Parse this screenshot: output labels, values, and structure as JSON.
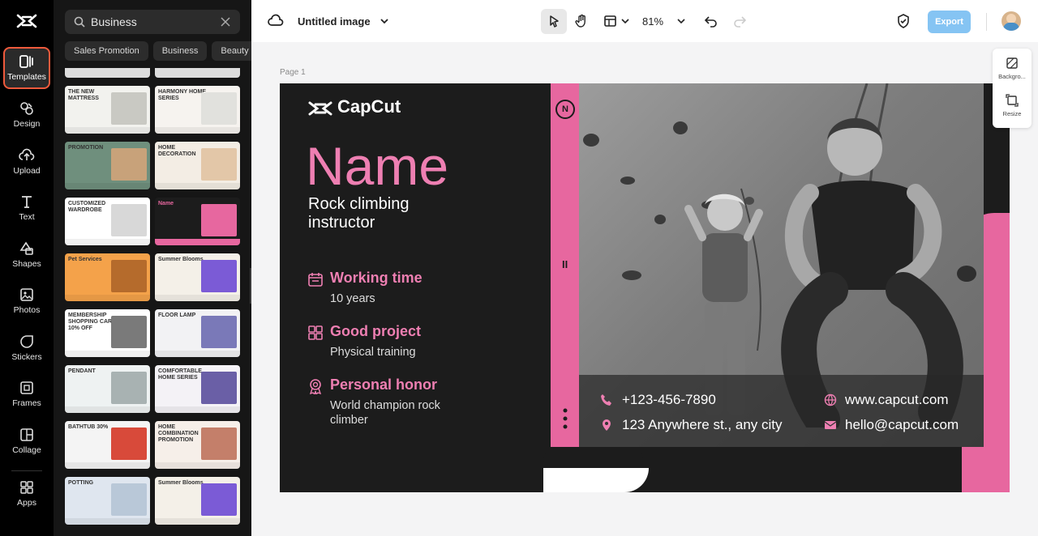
{
  "rail": {
    "items": [
      {
        "label": "Templates",
        "icon": "templates-icon",
        "active": true
      },
      {
        "label": "Design",
        "icon": "design-icon"
      },
      {
        "label": "Upload",
        "icon": "upload-icon"
      },
      {
        "label": "Text",
        "icon": "text-icon"
      },
      {
        "label": "Shapes",
        "icon": "shapes-icon"
      },
      {
        "label": "Photos",
        "icon": "photos-icon"
      },
      {
        "label": "Stickers",
        "icon": "stickers-icon"
      },
      {
        "label": "Frames",
        "icon": "frames-icon"
      },
      {
        "label": "Collage",
        "icon": "collage-icon"
      },
      {
        "label": "Apps",
        "icon": "apps-icon"
      }
    ]
  },
  "panel": {
    "search_value": "Business",
    "chips": [
      "Sales Promotion",
      "Business",
      "Beauty"
    ],
    "thumbs": [
      {
        "title": "THE NEW MATTRESS",
        "bg": "#f2f2ee",
        "accent": "#c9c9c3"
      },
      {
        "title": "HARMONY HOME SERIES",
        "bg": "#f6f3ef",
        "accent": "#e1e1dd"
      },
      {
        "title": "PROMOTION",
        "bg": "#6f8f7d",
        "accent": "#c8a27a"
      },
      {
        "title": "HOME DECORATION",
        "bg": "#f3ede4",
        "accent": "#e3c7a8"
      },
      {
        "title": "CUSTOMIZED WARDROBE",
        "bg": "#ffffff",
        "accent": "#d8d8d8"
      },
      {
        "title": "Name",
        "bg": "#1c1c1c",
        "accent": "#e7679f"
      },
      {
        "title": "Pet Services",
        "bg": "#f4a24a",
        "accent": "#b56b2c"
      },
      {
        "title": "Summer Blooms",
        "bg": "#f4f0e8",
        "accent": "#7b5bd6"
      },
      {
        "title": "MEMBERSHIP SHOPPING CARD 10% OFF",
        "bg": "#ffffff",
        "accent": "#7a7a7a"
      },
      {
        "title": "FLOOR LAMP",
        "bg": "#f2f2f4",
        "accent": "#7a79b8"
      },
      {
        "title": "PENDANT",
        "bg": "#eef2f2",
        "accent": "#a8b2b2"
      },
      {
        "title": "COMFORTABLE HOME SERIES",
        "bg": "#f4f2f6",
        "accent": "#6a5fa6"
      },
      {
        "title": "BATHTUB 30%",
        "bg": "#f4f4f4",
        "accent": "#d84a3a"
      },
      {
        "title": "HOME COMBINATION PROMOTION",
        "bg": "#f6efe9",
        "accent": "#c47f6a"
      },
      {
        "title": "POTTING",
        "bg": "#dfe6ef",
        "accent": "#b9c8d8"
      },
      {
        "title": "Summer Blooms",
        "bg": "#f4f0e8",
        "accent": "#7b5bd6"
      }
    ]
  },
  "topbar": {
    "title": "Untitled image",
    "zoom": "81%",
    "export_label": "Export"
  },
  "canvas": {
    "page_label": "Page 1",
    "right_panel": [
      {
        "label": "Backgro...",
        "icon": "background-icon"
      },
      {
        "label": "Resize",
        "icon": "resize-icon"
      }
    ]
  },
  "design": {
    "brand": "CapCut",
    "name": "Name",
    "role": "Rock climbing instructor",
    "sections": [
      {
        "heading": "Working time",
        "sub": "10 years",
        "icon": "calendar-icon"
      },
      {
        "heading": "Good project",
        "sub": "Physical training",
        "icon": "grid-icon"
      },
      {
        "heading": "Personal honor",
        "sub": "World champion rock climber",
        "icon": "award-icon"
      }
    ],
    "pink_circle": "N",
    "pink_pause": "II",
    "big_word": "CAPCUT",
    "contact": {
      "phone": "+123-456-7890",
      "address": "123 Anywhere st., any city",
      "web": "www.capcut.com",
      "email": "hello@capcut.com"
    }
  },
  "colors": {
    "accent_pink": "#e7679f",
    "export_blue": "#85c4f3",
    "active_outline": "#f05a3c"
  }
}
